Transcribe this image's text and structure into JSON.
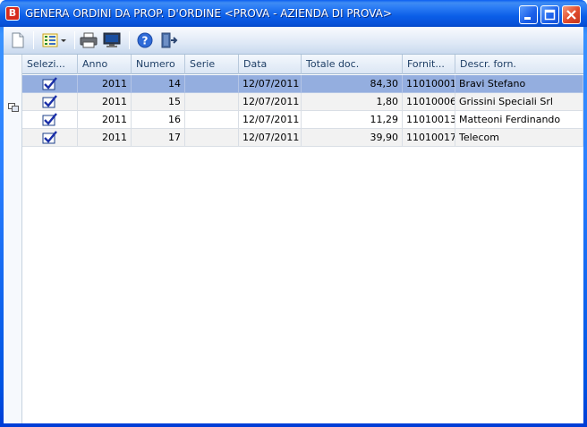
{
  "window": {
    "title": "GENERA ORDINI DA PROP. D'ORDINE <PROVA - AZIENDA DI PROVA>",
    "icon_letter": "B"
  },
  "toolbar": {
    "items": [
      {
        "name": "new-document-icon"
      },
      {
        "name": "columns-layout-icon"
      },
      {
        "name": "print-icon"
      },
      {
        "name": "preview-monitor-icon"
      },
      {
        "name": "help-icon"
      },
      {
        "name": "exit-door-icon"
      }
    ]
  },
  "grid": {
    "columns": [
      "Selezi...",
      "Anno",
      "Numero",
      "Serie",
      "Data",
      "Totale doc.",
      "Fornit...",
      "Descr. forn."
    ],
    "rows": [
      {
        "selected": true,
        "anno": "2011",
        "numero": "14",
        "serie": "",
        "data": "12/07/2011",
        "totale": "84,30",
        "fornitore": "11010001",
        "descr": "Bravi Stefano"
      },
      {
        "selected": true,
        "anno": "2011",
        "numero": "15",
        "serie": "",
        "data": "12/07/2011",
        "totale": "1,80",
        "fornitore": "11010006",
        "descr": "Grissini Speciali Srl"
      },
      {
        "selected": true,
        "anno": "2011",
        "numero": "16",
        "serie": "",
        "data": "12/07/2011",
        "totale": "11,29",
        "fornitore": "11010013",
        "descr": "Matteoni Ferdinando"
      },
      {
        "selected": true,
        "anno": "2011",
        "numero": "17",
        "serie": "",
        "data": "12/07/2011",
        "totale": "39,90",
        "fornitore": "11010017",
        "descr": "Telecom"
      }
    ],
    "active_row": 0
  },
  "colors": {
    "selection": "#94aedf",
    "header_text": "#1f3f66",
    "title_bar": "#0b5ee8"
  }
}
